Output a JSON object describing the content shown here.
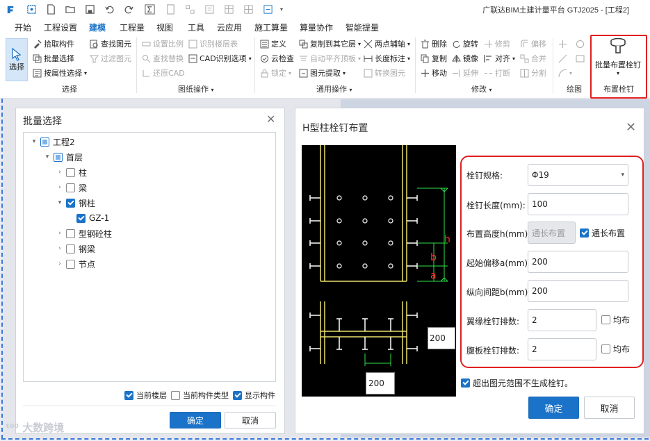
{
  "app": {
    "title": "广联达BIM土建计量平台 GTJ2025 - [工程2]"
  },
  "menu": [
    "开始",
    "工程设置",
    "建模",
    "工程量",
    "视图",
    "工具",
    "云应用",
    "施工算量",
    "算量协作",
    "智能提量"
  ],
  "ribbon": {
    "select": "选择",
    "pick": "拾取构件",
    "batch": "批量选择",
    "byattr": "按属性选择",
    "find": "查找图元",
    "filter": "过滤图元",
    "grp_select": "选择",
    "scale": "设置比例",
    "findrep": "查找替换",
    "restore": "还原CAD",
    "floor": "识别楼层表",
    "cadopt": "CAD识别选项",
    "grp_drawing": "图纸操作",
    "define": "定义",
    "cloudcheck": "云检查",
    "lock": "锁定",
    "copyto": "复制到其它层",
    "autoalign": "自动平齐顶板",
    "extract": "图元提取",
    "twopoint": "两点辅轴",
    "lengthmark": "长度标注",
    "convert": "转换图元",
    "grp_common": "通用操作",
    "delete": "删除",
    "copy": "复制",
    "move": "移动",
    "rotate": "旋转",
    "mirror": "镜像",
    "extend": "延伸",
    "trim": "修剪",
    "align": "对齐",
    "break": "打断",
    "offset": "偏移",
    "merge": "合并",
    "split": "分割",
    "grp_modify": "修改",
    "grp_draw": "绘图",
    "stud_batch": "批量布置栓钉",
    "grp_stud": "布置栓钉"
  },
  "batch_panel": {
    "title": "批量选择",
    "tree": {
      "root": "工程2",
      "floor": "首层",
      "items": [
        "柱",
        "梁",
        "钢柱",
        "GZ-1",
        "型钢砼柱",
        "钢梁",
        "节点"
      ]
    },
    "opt_current_floor": "当前楼层",
    "opt_current_type": "当前构件类型",
    "opt_show": "显示构件",
    "ok": "确定",
    "cancel": "取消"
  },
  "stud_panel": {
    "title": "H型柱栓钉布置",
    "labels": {
      "spec": "栓钉规格:",
      "length": "栓钉长度(mm):",
      "height": "布置高度h(mm):",
      "offset": "起始偏移a(mm):",
      "spacing": "纵向间距b(mm):",
      "flange_rows": "翼缘栓钉排数:",
      "web_rows": "腹板栓钉排数:"
    },
    "values": {
      "spec": "Φ19",
      "length": "100",
      "height": "通长布置",
      "offset": "200",
      "spacing": "200",
      "flange_rows": "2",
      "web_rows": "2"
    },
    "full_length": "通长布置",
    "uniform": "均布",
    "no_exceed": "超出图元范围不生成栓钉。",
    "canvas": {
      "h": "h",
      "b": "b",
      "a": "a",
      "dim_right": "200",
      "dim_bottom": "200"
    },
    "ok": "确定",
    "cancel": "取消"
  },
  "watermark": "大数跨境"
}
